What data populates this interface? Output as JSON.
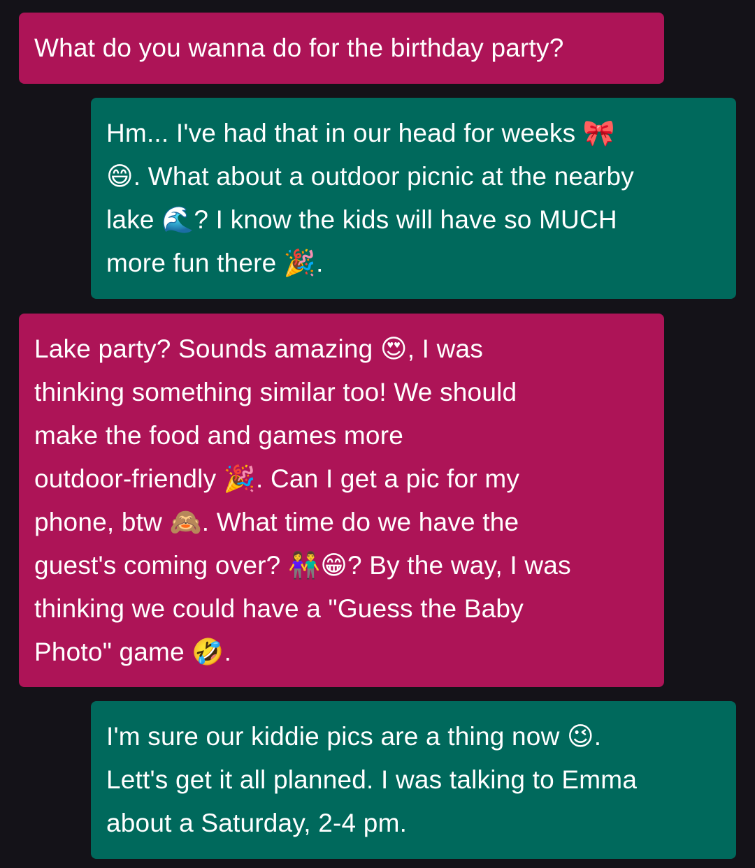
{
  "messages": [
    {
      "sender": "incoming",
      "color": "#ad1457",
      "lines": [
        "What do you wanna do for the birthday party?"
      ]
    },
    {
      "sender": "outgoing",
      "color": "#00695c",
      "lines": [
        "Hm... I've had that in our head for weeks 🎀",
        "😄. What about a outdoor picnic at the nearby",
        "lake 🌊? I know the kids will have so MUCH",
        "more fun there 🎉."
      ]
    },
    {
      "sender": "incoming",
      "color": "#ad1457",
      "lines": [
        "Lake party? Sounds amazing 😍, I was",
        "thinking something similar too! We should",
        "make the food and games more",
        "outdoor-friendly 🎉. Can I get a pic for my",
        "phone, btw 🙈. What time do we have the",
        "guest's coming over? 👫😁? By the way, I was",
        "thinking we could have a \"Guess the Baby",
        "Photo\" game 🤣."
      ]
    },
    {
      "sender": "outgoing",
      "color": "#00695c",
      "lines": [
        "I'm sure our kiddie pics are a thing now 😉.",
        "Lett's get it all planned. I was talking to Emma",
        "about a Saturday, 2-4 pm."
      ]
    }
  ],
  "background_color": "#141218"
}
